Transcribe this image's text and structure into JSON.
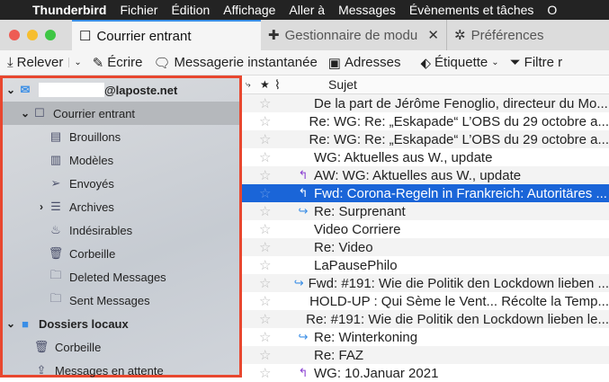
{
  "menubar": {
    "app": "Thunderbird",
    "items": [
      "Fichier",
      "Édition",
      "Affichage",
      "Aller à",
      "Messages",
      "Évènements et tâches",
      "O"
    ]
  },
  "tabs": [
    {
      "label": "Courrier entrant",
      "icon": "inbox-icon"
    },
    {
      "label": "Gestionnaire de modu",
      "icon": "puzzle-icon"
    },
    {
      "label": "Préférences",
      "icon": "gear-icon"
    }
  ],
  "toolbar": {
    "get": "Relever",
    "write": "Écrire",
    "chat": "Messagerie instantanée",
    "address": "Adresses",
    "tag": "Étiquette",
    "filter": "Filtre r"
  },
  "sidebar": {
    "account": "@laposte.net",
    "folders": [
      {
        "label": "Courrier entrant",
        "icon": "inbox-icon"
      },
      {
        "label": "Brouillons",
        "icon": "drafts-icon"
      },
      {
        "label": "Modèles",
        "icon": "templates-icon"
      },
      {
        "label": "Envoyés",
        "icon": "sent-icon"
      },
      {
        "label": "Archives",
        "icon": "archive-icon"
      },
      {
        "label": "Indésirables",
        "icon": "junk-icon"
      },
      {
        "label": "Corbeille",
        "icon": "trash-icon"
      },
      {
        "label": "Deleted Messages",
        "icon": "folder-icon"
      },
      {
        "label": "Sent Messages",
        "icon": "folder-icon"
      }
    ],
    "local": "Dossiers locaux",
    "local_folders": [
      {
        "label": "Corbeille",
        "icon": "trash-icon"
      },
      {
        "label": "Messages en attente",
        "icon": "outbox-icon"
      }
    ]
  },
  "list": {
    "header": "Sujet",
    "rows": [
      {
        "subject": "De la part de Jérôme Fenoglio, directeur du Mo...",
        "status": ""
      },
      {
        "subject": "Re: WG: Re: „Eskapade“ L’OBS du 29 octobre a...",
        "status": ""
      },
      {
        "subject": "Re: WG: Re: „Eskapade“ L’OBS du 29 octobre a...",
        "status": ""
      },
      {
        "subject": "WG: Aktuelles aus W., update",
        "status": ""
      },
      {
        "subject": "AW: WG: Aktuelles aus W., update",
        "status": "replied"
      },
      {
        "subject": "Fwd: Corona-Regeln in Frankreich: Autoritäres ...",
        "status": "replied",
        "selected": true
      },
      {
        "subject": "Re: Surprenant",
        "status": "forwarded"
      },
      {
        "subject": "Video Corriere",
        "status": ""
      },
      {
        "subject": "Re: Video",
        "status": ""
      },
      {
        "subject": "LaPausePhilo",
        "status": ""
      },
      {
        "subject": "Fwd: #191: Wie die Politik den Lockdown lieben ...",
        "status": "forwarded"
      },
      {
        "subject": "HOLD-UP : Qui Sème le Vent... Récolte la Temp...",
        "status": ""
      },
      {
        "subject": "Re: #191: Wie die Politik den Lockdown lieben le...",
        "status": ""
      },
      {
        "subject": "Re: Winterkoning",
        "status": "forwarded"
      },
      {
        "subject": "Re: FAZ",
        "status": ""
      },
      {
        "subject": "WG: 10.Januar 2021",
        "status": "replied"
      }
    ]
  },
  "colors": {
    "accent": "#1a65d8",
    "replied": "#8a3fd1",
    "forwarded": "#3a8ee6",
    "highlight": "#e8472f"
  }
}
